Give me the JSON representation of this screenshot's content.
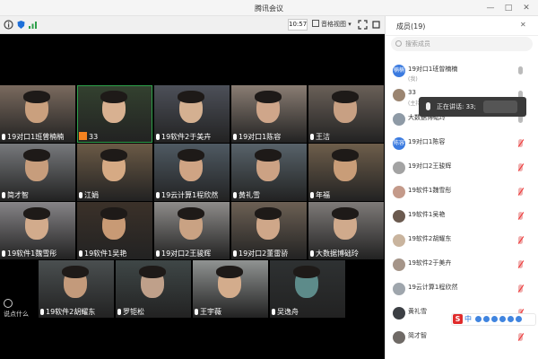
{
  "window": {
    "title": "腾讯会议",
    "min": "—",
    "max": "□",
    "close": "✕"
  },
  "toolbar": {
    "time": "10:57",
    "view_label": "音格视图"
  },
  "tiles": [
    {
      "name": "19对口1班曾楠楠",
      "bg": "#7a6a5e",
      "face": "#caa07e",
      "has_mic": true
    },
    {
      "name": "33",
      "bg": "#33412f",
      "face": "#d8b191",
      "has_mic": false,
      "active": true
    },
    {
      "name": "19软件2于美卉",
      "bg": "#4d5059",
      "face": "#d4b091",
      "has_mic": true
    },
    {
      "name": "19对口1陈容",
      "bg": "#8a7d73",
      "face": "#cfa68a",
      "has_mic": true
    },
    {
      "name": "王洁",
      "bg": "#6a6058",
      "face": "#c8a083",
      "has_mic": true
    },
    {
      "name": "简才智",
      "bg": "#77797c",
      "face": "#c79d7c",
      "has_mic": true
    },
    {
      "name": "江娟",
      "bg": "#6b5a46",
      "face": "#d6aa84",
      "has_mic": true
    },
    {
      "name": "19云计算1程欣然",
      "bg": "#4f5a63",
      "face": "#cfa484",
      "has_mic": true
    },
    {
      "name": "黄礼雪",
      "bg": "#58636a",
      "face": "#cca284",
      "has_mic": true
    },
    {
      "name": "年福",
      "bg": "#6e5e4b",
      "face": "#c99d78",
      "has_mic": true
    },
    {
      "name": "19软件1魏雪彤",
      "bg": "#868487",
      "face": "#d2ab8c",
      "has_mic": true
    },
    {
      "name": "19软件1吴艳",
      "bg": "#3b3129",
      "face": "#c89a75",
      "has_mic": true
    },
    {
      "name": "19对口2王骏辉",
      "bg": "#8e8c8a",
      "face": "#c9a283",
      "has_mic": true
    },
    {
      "name": "19对口2董雷骄",
      "bg": "#6c6054",
      "face": "#cfa789",
      "has_mic": true
    },
    {
      "name": "大数据博础玲",
      "bg": "#7e7a78",
      "face": "#d0aa8c",
      "has_mic": true
    },
    {
      "name": "19软件2胡耀东",
      "bg": "#4a4f50",
      "face": "#c39a7b",
      "has_mic": true
    },
    {
      "name": "罗钜松",
      "bg": "#3f4747",
      "face": "#bfa08a",
      "has_mic": true
    },
    {
      "name": "王宇薇",
      "bg": "#909392",
      "face": "#d3ac8c",
      "has_mic": true
    },
    {
      "name": "吴逸舟",
      "bg": "#2e3132",
      "face": "#5d8b8a",
      "has_mic": true
    }
  ],
  "say_label": "说点什么",
  "panel": {
    "title": "成员(19)",
    "close": "✕",
    "search_placeholder": "搜索成员",
    "members": [
      {
        "name": "19对口1班曾楠楠",
        "sub": "(我)",
        "avatar_text": "楠楠",
        "avatar_color": "#3b7be0",
        "mic_off": false
      },
      {
        "name": "33",
        "sub": "(主持人)",
        "avatar_text": "",
        "avatar_color": "#9b8571",
        "mic_off": false
      },
      {
        "name": "大数据博础玲",
        "sub": "",
        "avatar_text": "",
        "avatar_color": "#8e9aa6",
        "mic_off": false
      },
      {
        "name": "19对口1陈容",
        "sub": "",
        "avatar_text": "陈容",
        "avatar_color": "#3b7be0",
        "mic_off": true
      },
      {
        "name": "19对口2王骏辉",
        "sub": "",
        "avatar_text": "",
        "avatar_color": "#a3a3a3",
        "mic_off": true
      },
      {
        "name": "19软件1魏雪彤",
        "sub": "",
        "avatar_text": "",
        "avatar_color": "#c49a8a",
        "mic_off": true
      },
      {
        "name": "19软件1吴艳",
        "sub": "",
        "avatar_text": "",
        "avatar_color": "#6b5a4f",
        "mic_off": true
      },
      {
        "name": "19软件2胡耀东",
        "sub": "",
        "avatar_text": "",
        "avatar_color": "#c9b49e",
        "mic_off": true
      },
      {
        "name": "19软件2于美卉",
        "sub": "",
        "avatar_text": "",
        "avatar_color": "#a59589",
        "mic_off": true
      },
      {
        "name": "19云计算1程欣然",
        "sub": "",
        "avatar_text": "",
        "avatar_color": "#9fa6ad",
        "mic_off": true
      },
      {
        "name": "黄礼雪",
        "sub": "",
        "avatar_text": "",
        "avatar_color": "#3c3f44",
        "mic_off": true
      },
      {
        "name": "简才智",
        "sub": "",
        "avatar_text": "",
        "avatar_color": "#6f6a66",
        "mic_off": true
      }
    ]
  },
  "speaking": {
    "label": "正在讲话: 33;"
  },
  "ime": {
    "logo": "S",
    "text": "中"
  }
}
